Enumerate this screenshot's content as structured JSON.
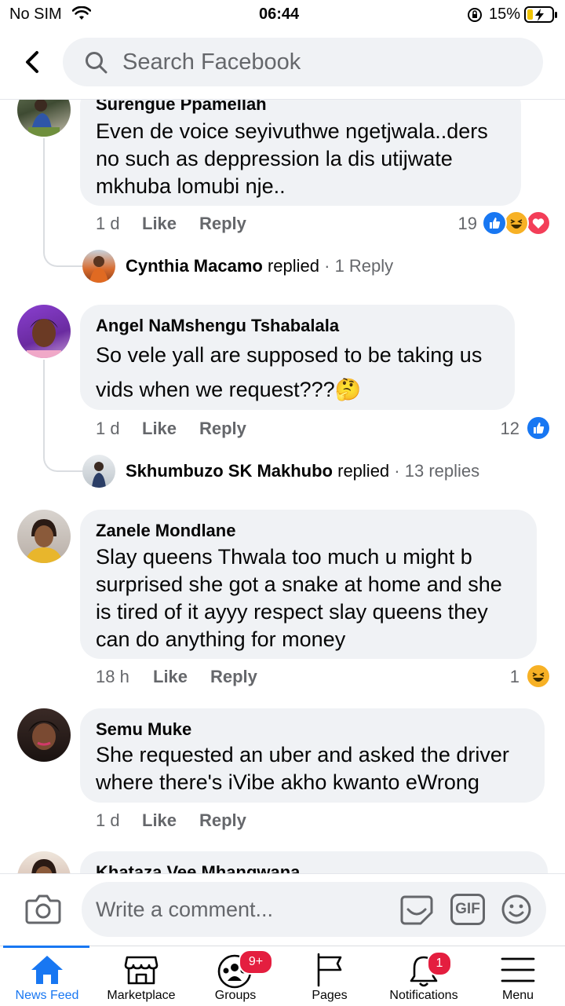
{
  "status_bar": {
    "carrier": "No SIM",
    "time": "06:44",
    "battery": "15%"
  },
  "header": {
    "search_placeholder": "Search Facebook"
  },
  "comments": [
    {
      "author": "Surengue Ppamellah",
      "lines": [
        "Even de voice seyivuthwe ngetjwala..ders",
        "no such as deppression la dis  utijwate",
        "mkhuba lomubi nje.."
      ],
      "time": "1 d",
      "like": "Like",
      "reply": "Reply",
      "reaction_count": "19",
      "reactions": [
        "like",
        "haha",
        "love"
      ],
      "reply_preview": {
        "name": "Cynthia Macamo",
        "verb": "replied",
        "count": "· 1 Reply"
      }
    },
    {
      "author": "Angel NaMshengu Tshabalala",
      "lines": [
        "So vele yall are supposed to be taking us",
        "vids when we request???🤔"
      ],
      "time": "1 d",
      "like": "Like",
      "reply": "Reply",
      "reaction_count": "12",
      "reactions": [
        "like"
      ],
      "reply_preview": {
        "name": "Skhumbuzo SK Makhubo",
        "verb": "replied",
        "count": "· 13 replies"
      }
    },
    {
      "author": "Zanele Mondlane",
      "lines": [
        "Slay queens Thwala too much u might b",
        "surprised she got a snake at home and she",
        "is tired of it ayyy respect slay queens they",
        "can do anything for money"
      ],
      "time": "18 h",
      "like": "Like",
      "reply": "Reply",
      "reaction_count": "1",
      "reactions": [
        "haha"
      ]
    },
    {
      "author": "Semu Muke",
      "lines": [
        "She requested an uber and asked the driver",
        "where there's iVibe akho kwanto eWrong"
      ],
      "time": "1 d",
      "like": "Like",
      "reply": "Reply"
    },
    {
      "author": "Khataza Vee Mhangwana"
    }
  ],
  "composer": {
    "placeholder": "Write a comment...",
    "gif_label": "GIF"
  },
  "tabs": [
    {
      "label": "News Feed",
      "icon": "home-icon",
      "active": true
    },
    {
      "label": "Marketplace",
      "icon": "marketplace-icon"
    },
    {
      "label": "Groups",
      "icon": "groups-icon",
      "badge": "9+"
    },
    {
      "label": "Pages",
      "icon": "pages-icon"
    },
    {
      "label": "Notifications",
      "icon": "bell-icon",
      "badge": "1"
    },
    {
      "label": "Menu",
      "icon": "menu-icon"
    }
  ],
  "colors": {
    "accent": "#1877f2",
    "bubble": "#f0f2f5",
    "muted_text": "#65676b",
    "badge": "#e41e3f"
  }
}
